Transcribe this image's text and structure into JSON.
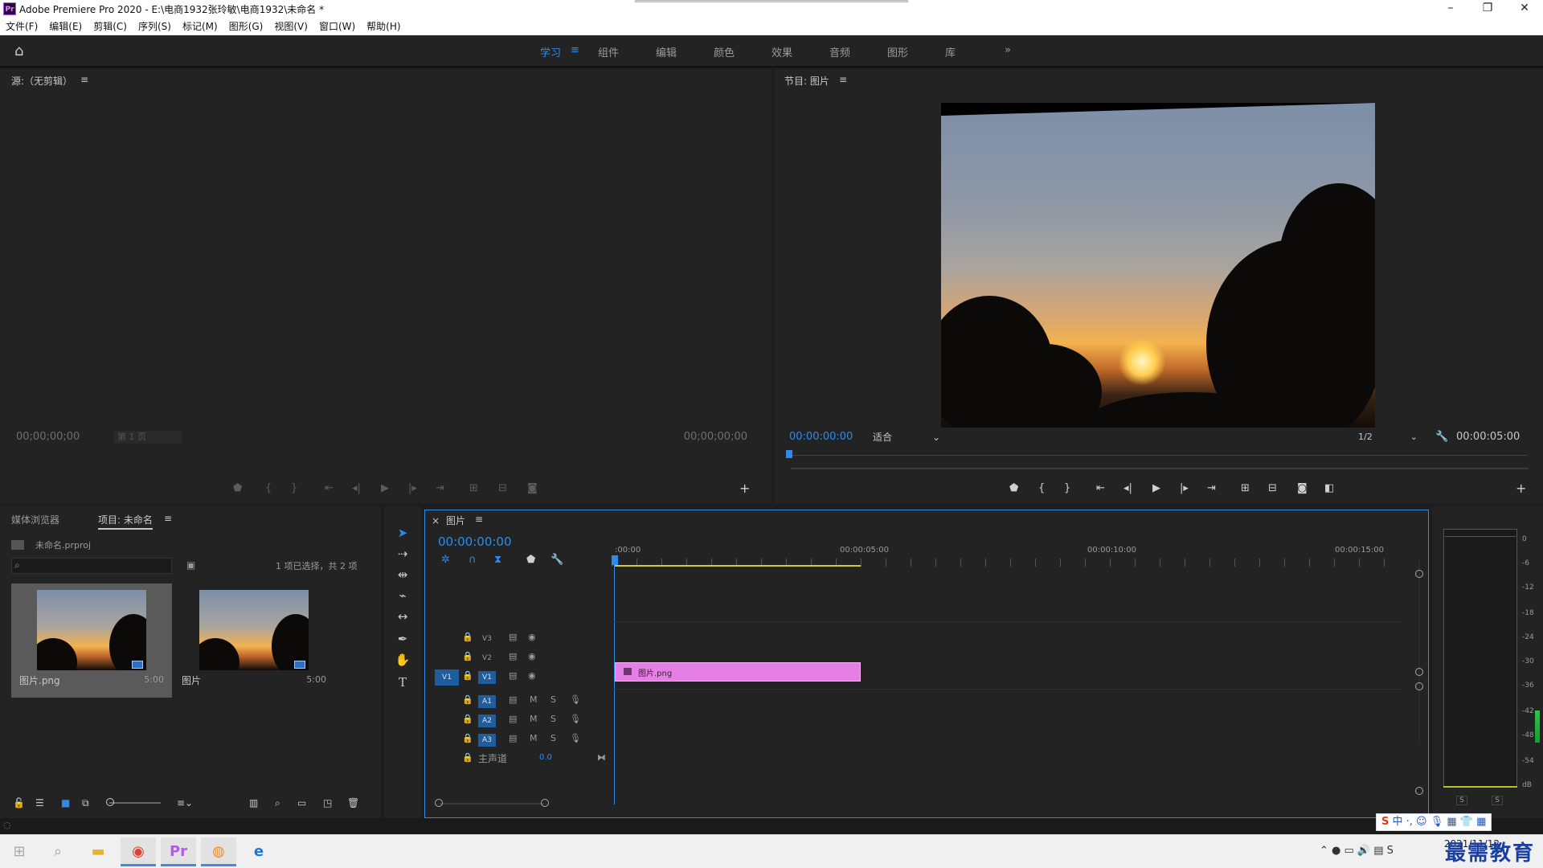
{
  "window": {
    "title": "Adobe Premiere Pro 2020 - E:\\电商1932张玲敏\\电商1932\\未命名 *",
    "app_icon": "Pr"
  },
  "menu": [
    "文件(F)",
    "编辑(E)",
    "剪辑(C)",
    "序列(S)",
    "标记(M)",
    "图形(G)",
    "视图(V)",
    "窗口(W)",
    "帮助(H)"
  ],
  "workspaces": {
    "tabs": [
      "学习",
      "组件",
      "编辑",
      "颜色",
      "效果",
      "音频",
      "图形",
      "库"
    ],
    "active": "学习",
    "more_label": "»"
  },
  "source_monitor": {
    "title": "源:（无剪辑）",
    "timecode_in": "00;00;00;00",
    "page_select": "第 1 页",
    "timecode_out": "00;00;00;00"
  },
  "program_monitor": {
    "title": "节目: 图片",
    "timecode": "00:00:00:00",
    "fit": "适合",
    "resolution": "1/2",
    "duration": "00:00:05:00"
  },
  "project": {
    "tabs": [
      "媒体浏览器",
      "项目: 未命名"
    ],
    "active_tab": "项目: 未命名",
    "file": "未命名.prproj",
    "search_placeholder": "",
    "selection_info": "1 项已选择，共 2 项",
    "items": [
      {
        "name": "图片.png",
        "duration": "5:00",
        "selected": true
      },
      {
        "name": "图片",
        "duration": "5:00",
        "selected": false
      }
    ]
  },
  "timeline": {
    "title": "图片",
    "timecode": "00:00:00:00",
    "ruler": [
      ":00:00",
      "00:00:05:00",
      "00:00:10:00",
      "00:00:15:00"
    ],
    "video_tracks": [
      "V3",
      "V2",
      "V1"
    ],
    "audio_tracks": [
      "A1",
      "A2",
      "A3"
    ],
    "source_patch": "V1",
    "master": {
      "label": "主声道",
      "value": "0.0"
    },
    "mute_label": "M",
    "solo_label": "S",
    "clip": {
      "name": "图片.png",
      "color": "#e57ee5"
    }
  },
  "meter": {
    "scale": [
      "0",
      "-6",
      "-12",
      "-18",
      "-24",
      "-30",
      "-36",
      "-42",
      "-48",
      "-54",
      "dB"
    ],
    "solo_labels": [
      "S",
      "S"
    ]
  },
  "taskbar": {
    "time": "",
    "date": "2021/11/12",
    "watermark": "最需教育",
    "ime_label": "中"
  },
  "colors": {
    "accent": "#2d8ceb",
    "clip": "#e57ee5",
    "panel": "#232323"
  }
}
